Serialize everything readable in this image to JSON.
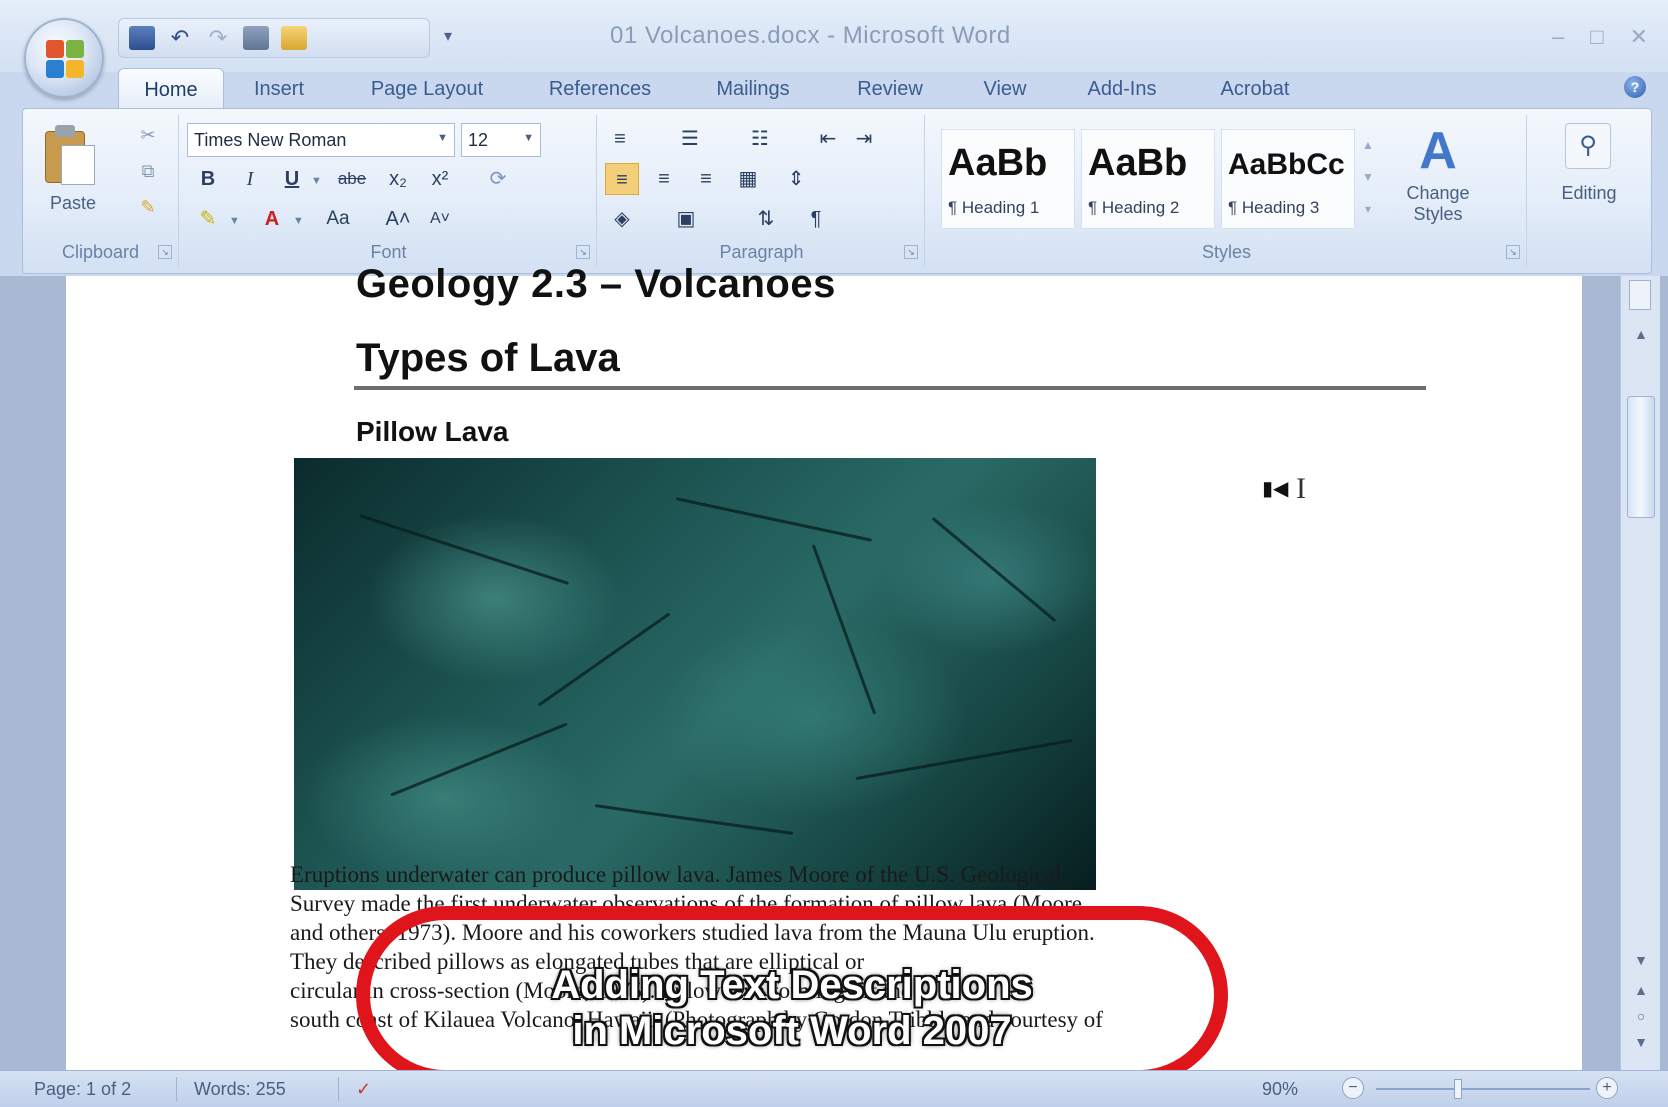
{
  "window": {
    "title": "01 Volcanoes.docx - Microsoft Word"
  },
  "tabs": [
    "Home",
    "Insert",
    "Page Layout",
    "References",
    "Mailings",
    "Review",
    "View",
    "Add-Ins",
    "Acrobat"
  ],
  "ribbon": {
    "clipboard": {
      "paste_label": "Paste",
      "group_label": "Clipboard"
    },
    "font": {
      "font_name": "Times New Roman",
      "font_size": "12",
      "bold": "B",
      "italic": "I",
      "underline": "U",
      "strike": "abe",
      "subscript": "x₂",
      "superscript": "x²",
      "change_case": "Aa",
      "grow": "A˄",
      "shrink": "A˅",
      "group_label": "Font"
    },
    "paragraph": {
      "group_label": "Paragraph"
    },
    "styles": {
      "items": [
        {
          "sample": "AaBb",
          "name": "¶ Heading 1"
        },
        {
          "sample": "AaBb",
          "name": "¶ Heading 2"
        },
        {
          "sample": "AaBbCc",
          "name": "¶ Heading 3"
        }
      ],
      "change_styles_label": "Change Styles",
      "group_label": "Styles"
    },
    "editing": {
      "label": "Editing"
    }
  },
  "document": {
    "heading_top": "Geology 2.3 – Volcanoes",
    "heading_main": "Types of Lava",
    "subheading": "Pillow Lava",
    "body_lines": [
      "Eruptions underwater can produce pillow lava. James Moore of the U.S. Geological",
      "Survey made the first underwater observations of the formation of pillow lava (Moore",
      "and others, 1973). Moore and his coworkers studied lava from the Mauna Ulu eruption.",
      "They described pillows as elongated tubes that are elliptical or",
      "circular in cross-section (Moore, 1975). Pillow lava forming off the",
      "south coast of Kilauea Volcano, Hawaii. (Photograph by Gordon Tribble and courtesy of"
    ]
  },
  "overlay": {
    "line1": "Adding Text Descriptions",
    "line2": "in Microsoft Word 2007"
  },
  "statusbar": {
    "page": "Page: 1 of 2",
    "words": "Words: 255",
    "zoom": "90%"
  },
  "colors": {
    "callout_red": "#e0141b",
    "ribbon_blue": "#dbe7f6"
  }
}
